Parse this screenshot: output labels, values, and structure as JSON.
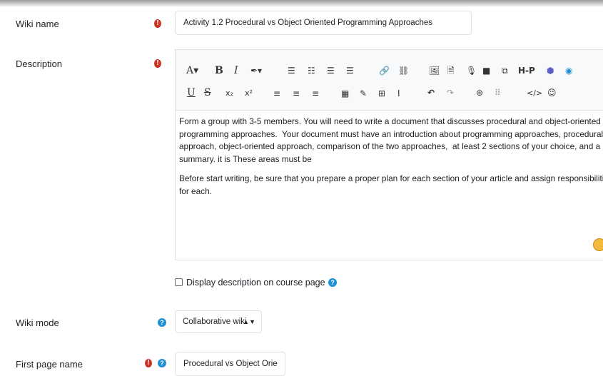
{
  "fields": {
    "wiki_name": {
      "label": "Wiki name",
      "value": "Activity 1.2 Procedural vs Object Oriented Programming Approaches"
    },
    "description": {
      "label": "Description",
      "paragraphs": [
        "Form a group with 3-5 members. You will need to write a document that discusses procedural and object-oriented programming approaches.  Your document must have an introduction about programming approaches, procedural approach, object-oriented approach, comparison of the two approaches,  at least 2 sections of your choice, and a summary. it is These areas must be",
        "Before start writing, be sure that you prepare a proper plan for each section of your article and assign responsibilities for each."
      ]
    },
    "display_description": {
      "label": "Display description on course page"
    },
    "wiki_mode": {
      "label": "Wiki mode",
      "value": "Collaborative wiki"
    },
    "first_page_name": {
      "label": "First page name",
      "value": "Procedural vs Object Orie"
    }
  },
  "toolbar": {
    "font_size": "A▾",
    "bold": "B",
    "italic": "I",
    "color": "✒▾",
    "h5p": "H-P",
    "underline": "U",
    "strike": "S",
    "subscript": "x₂",
    "superscript": "x²",
    "code": "</>"
  },
  "icons": {
    "required": "!",
    "help": "?"
  },
  "colors": {
    "required": "#ca3120",
    "help": "#1f8fd6",
    "border": "#dee2e6"
  }
}
